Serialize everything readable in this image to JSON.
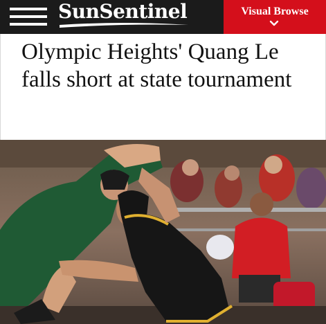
{
  "header": {
    "logo_text": "SunSentinel",
    "visual_browse_label": "Visual Browse"
  },
  "article": {
    "headline": "Olympic Heights' Quang Le falls short at state tournament"
  },
  "icons": {
    "menu": "hamburger-menu-icon",
    "chevron": "chevron-down-icon"
  },
  "colors": {
    "header_bg": "#1b1b1b",
    "visual_browse_bg": "#d40f1b",
    "headline_text": "#111111"
  }
}
